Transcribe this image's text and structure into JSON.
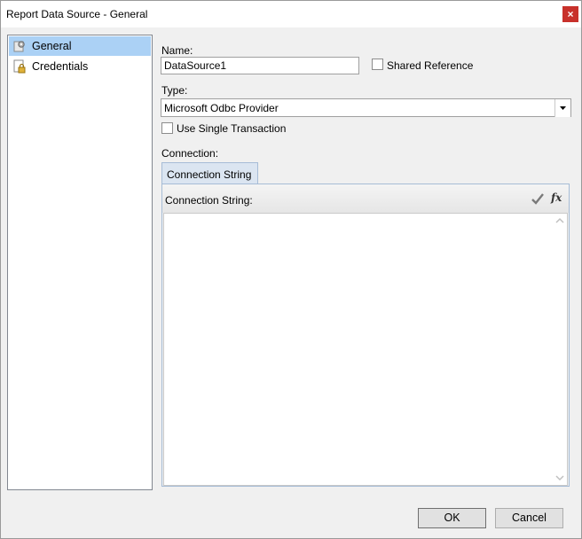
{
  "window": {
    "title": "Report Data Source - General",
    "close_label": "×"
  },
  "nav": {
    "items": [
      {
        "label": "General",
        "icon": "gear-doc-icon",
        "selected": true
      },
      {
        "label": "Credentials",
        "icon": "lock-doc-icon",
        "selected": false
      }
    ]
  },
  "form": {
    "name_label": "Name:",
    "name_value": "DataSource1",
    "shared_reference_label": "Shared Reference",
    "shared_reference_checked": false,
    "type_label": "Type:",
    "type_value": "Microsoft Odbc Provider",
    "use_single_transaction_label": "Use Single Transaction",
    "use_single_transaction_checked": false,
    "connection_label": "Connection:",
    "tab_label": "Connection String",
    "connection_string_label": "Connection String:",
    "connection_string_value": "",
    "validate_icon": "checkmark-icon",
    "expression_icon": "fx-icon"
  },
  "buttons": {
    "ok": "OK",
    "cancel": "Cancel"
  }
}
